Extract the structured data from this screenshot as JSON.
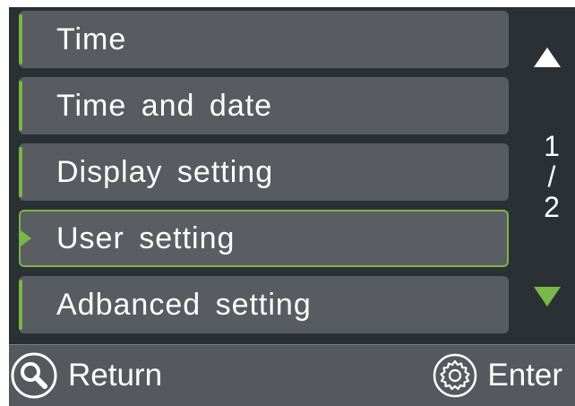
{
  "menu": {
    "items": [
      {
        "label": "Time",
        "selected": false
      },
      {
        "label": "Time and date",
        "selected": false
      },
      {
        "label": "Display setting",
        "selected": false
      },
      {
        "label": "User setting",
        "selected": true
      },
      {
        "label": "Adbanced setting",
        "selected": false
      }
    ]
  },
  "pager": {
    "current": "1",
    "separator": "/",
    "total": "2"
  },
  "footer": {
    "return_label": "Return",
    "enter_label": "Enter"
  },
  "icons": {
    "return": "search-icon",
    "enter": "gear-icon",
    "up": "triangle-up-icon",
    "down": "triangle-down-icon"
  },
  "colors": {
    "accent": "#7ab648",
    "panel": "#2b3035",
    "item": "#585c60",
    "text": "#ffffff"
  }
}
